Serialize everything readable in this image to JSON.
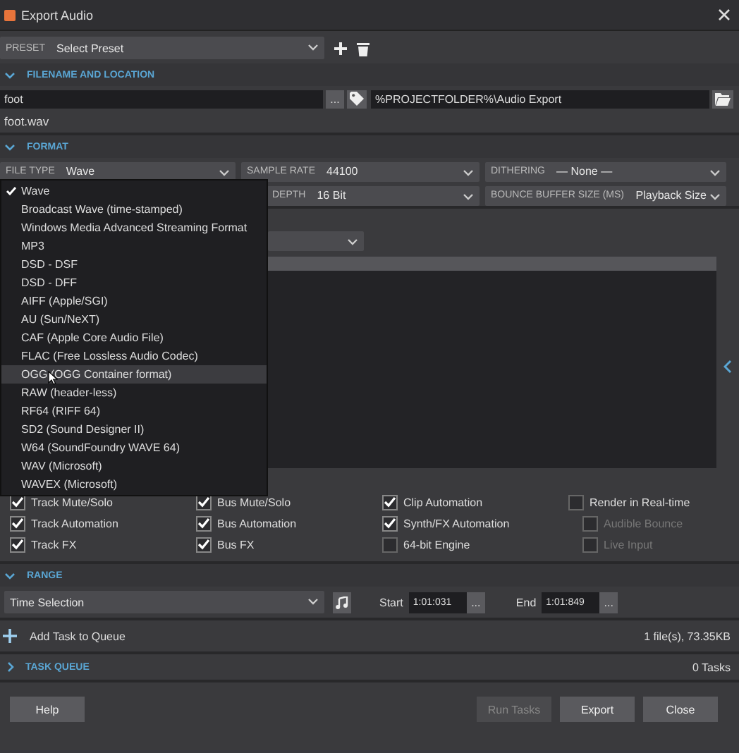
{
  "window": {
    "title": "Export Audio"
  },
  "preset": {
    "label": "PRESET",
    "value": "Select Preset"
  },
  "filename_section": {
    "title": "FILENAME AND LOCATION",
    "expanded": true,
    "name": "foot",
    "browse": "...",
    "folder": "%PROJECTFOLDER%\\Audio Export",
    "result": "foot.wav"
  },
  "format_section": {
    "title": "FORMAT",
    "expanded": true,
    "fields": [
      {
        "label": "FILE TYPE",
        "value": "Wave"
      },
      {
        "label": "SAMPLE RATE",
        "value": "44100"
      },
      {
        "label": "DITHERING",
        "value": "— None —"
      },
      {
        "label": "DEPTH",
        "value": "16 Bit"
      },
      {
        "label": "BOUNCE BUFFER SIZE (MS)",
        "value": "Playback Size"
      }
    ]
  },
  "file_type_menu": [
    {
      "label": "Wave",
      "selected": true,
      "hovered": false
    },
    {
      "label": "Broadcast Wave (time-stamped)",
      "selected": false,
      "hovered": false
    },
    {
      "label": "Windows Media Advanced Streaming Format",
      "selected": false,
      "hovered": false
    },
    {
      "label": "MP3",
      "selected": false,
      "hovered": false
    },
    {
      "label": "DSD - DSF",
      "selected": false,
      "hovered": false
    },
    {
      "label": "DSD - DFF",
      "selected": false,
      "hovered": false
    },
    {
      "label": "AIFF (Apple/SGI)",
      "selected": false,
      "hovered": false
    },
    {
      "label": "AU (Sun/NeXT)",
      "selected": false,
      "hovered": false
    },
    {
      "label": "CAF (Apple Core Audio File)",
      "selected": false,
      "hovered": false
    },
    {
      "label": "FLAC (Free Lossless Audio Codec)",
      "selected": false,
      "hovered": false
    },
    {
      "label": "OGG (OGG Container format)",
      "selected": false,
      "hovered": true
    },
    {
      "label": "RAW (header-less)",
      "selected": false,
      "hovered": false
    },
    {
      "label": "RF64 (RIFF 64)",
      "selected": false,
      "hovered": false
    },
    {
      "label": "SD2 (Sound Designer II)",
      "selected": false,
      "hovered": false
    },
    {
      "label": "W64 (SoundFoundry WAVE 64)",
      "selected": false,
      "hovered": false
    },
    {
      "label": "WAV (Microsoft)",
      "selected": false,
      "hovered": false
    },
    {
      "label": "WAVEX (Microsoft)",
      "selected": false,
      "hovered": false
    }
  ],
  "options": [
    {
      "label": "Track Mute/Solo",
      "checked": true,
      "disabled": false
    },
    {
      "label": "Bus Mute/Solo",
      "checked": true,
      "disabled": false
    },
    {
      "label": "Clip Automation",
      "checked": true,
      "disabled": false
    },
    {
      "label": "Render in Real-time",
      "checked": false,
      "disabled": false
    },
    {
      "label": "Track Automation",
      "checked": true,
      "disabled": false
    },
    {
      "label": "Bus Automation",
      "checked": true,
      "disabled": false
    },
    {
      "label": "Synth/FX Automation",
      "checked": true,
      "disabled": false
    },
    {
      "label": "Audible Bounce",
      "checked": false,
      "disabled": true
    },
    {
      "label": "Track FX",
      "checked": true,
      "disabled": false
    },
    {
      "label": "Bus FX",
      "checked": true,
      "disabled": false
    },
    {
      "label": "64-bit Engine",
      "checked": false,
      "disabled": false
    },
    {
      "label": "Live Input",
      "checked": false,
      "disabled": true
    }
  ],
  "range_section": {
    "title": "RANGE",
    "expanded": true,
    "mode": "Time Selection",
    "start_label": "Start",
    "start": "1:01:031",
    "end_label": "End",
    "end": "1:01:849",
    "browse": "..."
  },
  "queue": {
    "add_label": "Add Task to Queue",
    "size": "1 file(s), 73.35KB"
  },
  "task_queue": {
    "title": "TASK QUEUE",
    "expanded": false,
    "count": "0 Tasks"
  },
  "buttons": [
    {
      "label": "Help",
      "disabled": false
    },
    {
      "label": "Run Tasks",
      "disabled": true
    },
    {
      "label": "Export",
      "disabled": false
    },
    {
      "label": "Close",
      "disabled": false
    }
  ]
}
